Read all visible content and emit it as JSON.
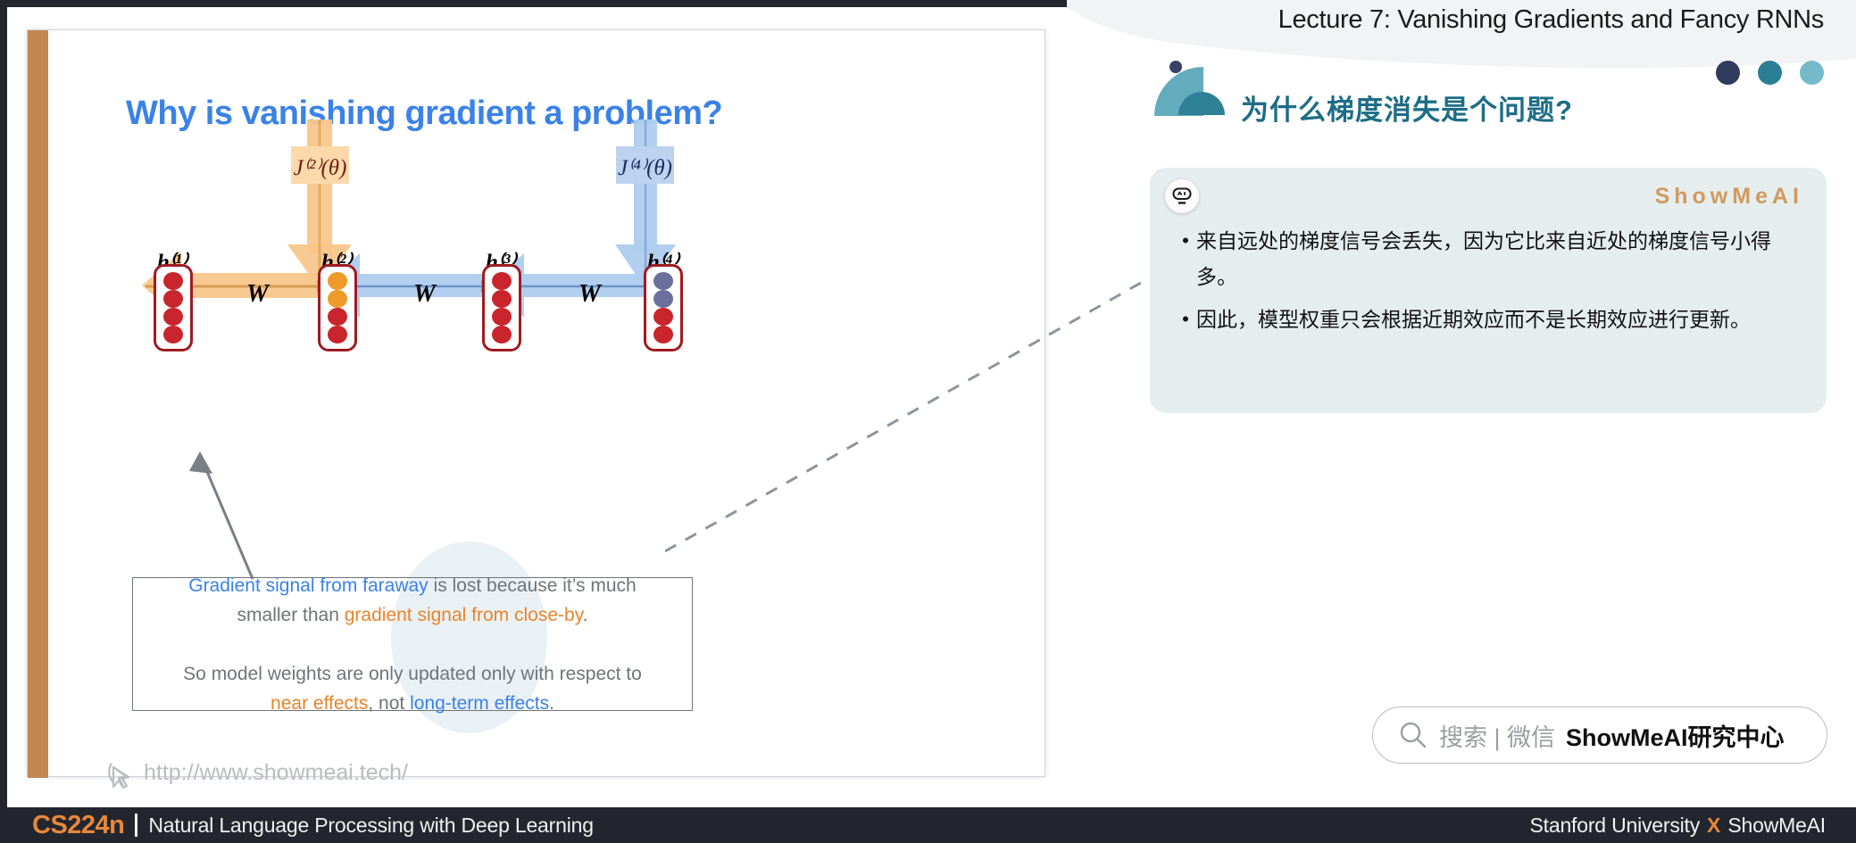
{
  "lecture": {
    "title": "Lecture 7: Vanishing Gradients and Fancy RNNs",
    "cn_title": "为什么梯度消失是个问题?"
  },
  "slide": {
    "title": "Why is vanishing gradient a problem?",
    "url": "http://www.showmeai.tech/",
    "loss_labels": {
      "j2": "J⁽²⁾(θ)",
      "j4": "J⁽⁴⁾(θ)"
    },
    "hidden_labels": [
      "h⁽¹⁾",
      "h⁽²⁾",
      "h⁽³⁾",
      "h⁽⁴⁾"
    ],
    "weight_labels": [
      "W",
      "W",
      "W"
    ],
    "explanation": {
      "line1_a": "Gradient signal from faraway",
      "line1_b": " is lost because it’s much",
      "line2_a": "smaller than ",
      "line2_b": "gradient signal from close-by",
      "line2_c": ".",
      "line3_a": "So model weights are only updated only with respect to",
      "line4_a": "near effects",
      "line4_b": ", not ",
      "line4_c": "long-term effects",
      "line4_d": "."
    }
  },
  "panel": {
    "brand": "ShowMeAI",
    "bullets": [
      {
        "bullet": "•",
        "text": "来自远处的梯度信号会丢失，因为它比来自近处的梯度信号小得多。"
      },
      {
        "bullet": "•",
        "text": "因此，模型权重只会根据近期效应而不是长期效应进行更新。"
      }
    ]
  },
  "search": {
    "placeholder_gray": "搜索 | 微信",
    "account": "ShowMeAI研究中心"
  },
  "footer": {
    "course_code": "CS224n",
    "course_name": "Natural Language Processing with Deep Learning",
    "org_left": "Stanford University",
    "org_x": "X",
    "org_right": "ShowMeAI"
  },
  "colors": {
    "accent_blue": "#3b82e8",
    "accent_orange": "#e8842a",
    "node_red": "#c9252d",
    "teal": "#2b7f95",
    "tan_bar": "#c2874f",
    "footer_bg": "#23262e"
  }
}
